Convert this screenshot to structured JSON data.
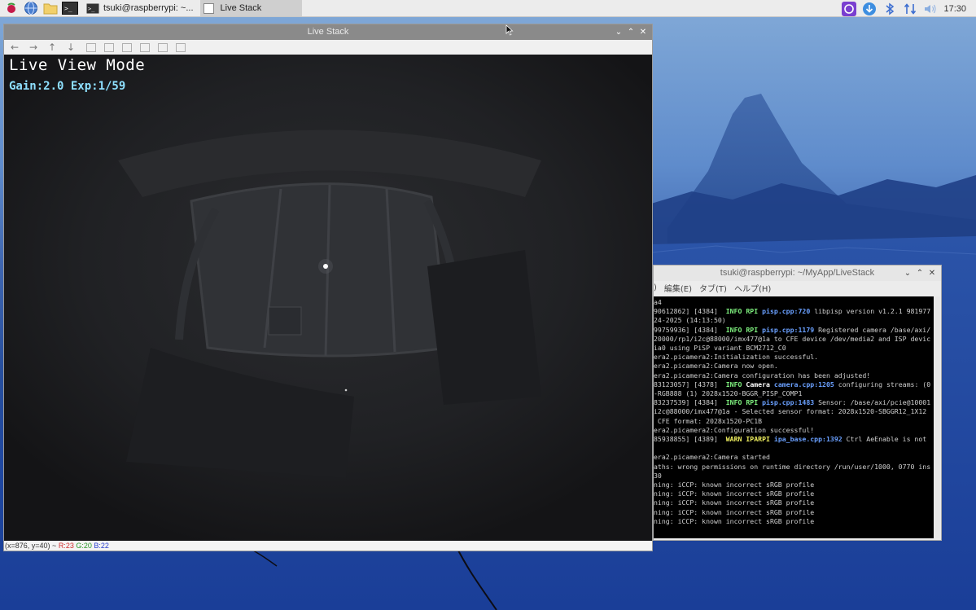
{
  "taskbar": {
    "icons": [
      "raspberry-menu-icon",
      "browser-globe-icon",
      "file-manager-folder-icon",
      "terminal-icon"
    ],
    "tasks": [
      {
        "label": "tsuki@raspberrypi: ~...",
        "icon": "terminal-icon",
        "active": false
      },
      {
        "label": "Live Stack",
        "icon": "window-icon",
        "active": true
      }
    ],
    "tray_icons": [
      "app-tray-icon",
      "download-update-icon",
      "bluetooth-icon",
      "network-arrows-icon",
      "volume-icon"
    ],
    "clock": "17:30"
  },
  "live_window": {
    "title": "Live Stack",
    "controls": [
      "minimize",
      "maximize",
      "close"
    ],
    "toolbar": [
      "back-arrow-icon",
      "forward-arrow-icon",
      "up-arrow-icon",
      "down-arrow-icon",
      "zoom-fit-icon",
      "zoom-in-icon",
      "zoom-out-icon",
      "save-icon",
      "copy-icon",
      "properties-icon"
    ],
    "overlay": {
      "mode": "Live View Mode",
      "gain_exposure": "Gain:2.0 Exp:1/59"
    },
    "status": {
      "coords": "(x=876, y=40) ~",
      "r": "R:23",
      "g": "G:20",
      "b": "B:22"
    }
  },
  "terminal_window": {
    "title": "tsuki@raspberrypi: ~/MyApp/LiveStack",
    "menu": [
      ")",
      "編集(E)",
      "タブ(T)",
      "ヘルプ(H)"
    ],
    "lines": [
      [
        {
          "t": "a4",
          "c": ""
        }
      ],
      [
        {
          "t": "90612862] [4384]  ",
          "c": ""
        },
        {
          "t": "INFO RPI ",
          "c": "info"
        },
        {
          "t": "pisp.cpp:720",
          "c": "src"
        },
        {
          "t": " libpisp version v1.2.1 981977",
          "c": ""
        }
      ],
      [
        {
          "t": "24-2025 (14:13:50)",
          "c": ""
        }
      ],
      [
        {
          "t": "99759936] [4384]  ",
          "c": ""
        },
        {
          "t": "INFO RPI ",
          "c": "info"
        },
        {
          "t": "pisp.cpp:1179",
          "c": "src"
        },
        {
          "t": " Registered camera /base/axi/",
          "c": ""
        }
      ],
      [
        {
          "t": "20000/rp1/i2c@88000/imx477@1a to CFE device /dev/media2 and ISP devic",
          "c": ""
        }
      ],
      [
        {
          "t": "ia0 using PiSP variant BCM2712_C0",
          "c": ""
        }
      ],
      [
        {
          "t": "era2.picamera2:Initialization successful.",
          "c": ""
        }
      ],
      [
        {
          "t": "era2.picamera2:Camera now open.",
          "c": ""
        }
      ],
      [
        {
          "t": "era2.picamera2:Camera configuration has been adjusted!",
          "c": ""
        }
      ],
      [
        {
          "t": "83123057] [4378]  ",
          "c": ""
        },
        {
          "t": "INFO ",
          "c": "info"
        },
        {
          "t": "Camera ",
          "c": "wb"
        },
        {
          "t": "camera.cpp:1205",
          "c": "src"
        },
        {
          "t": " configuring streams: (0",
          "c": ""
        }
      ],
      [
        {
          "t": "-RGB888 (1) 2028x1520-BGGR_PISP_COMP1",
          "c": ""
        }
      ],
      [
        {
          "t": "83237539] [4384]  ",
          "c": ""
        },
        {
          "t": "INFO RPI ",
          "c": "info"
        },
        {
          "t": "pisp.cpp:1483",
          "c": "src"
        },
        {
          "t": " Sensor: /base/axi/pcie@10001",
          "c": ""
        }
      ],
      [
        {
          "t": "i2c@88000/imx477@1a - Selected sensor format: 2028x1520-SBGGR12_1X12",
          "c": ""
        }
      ],
      [
        {
          "t": " CFE format: 2028x1520-PC1B",
          "c": ""
        }
      ],
      [
        {
          "t": "era2.picamera2:Configuration successful!",
          "c": ""
        }
      ],
      [
        {
          "t": "85938855] [4389]  ",
          "c": ""
        },
        {
          "t": "WARN IPARPI ",
          "c": "warn"
        },
        {
          "t": "ipa_base.cpp:1392",
          "c": "src"
        },
        {
          "t": " Ctrl AeEnable is not",
          "c": ""
        }
      ],
      [
        {
          "t": "",
          "c": ""
        }
      ],
      [
        {
          "t": "era2.picamera2:Camera started",
          "c": ""
        }
      ],
      [
        {
          "t": "aths: wrong permissions on runtime directory /run/user/1000, 0770 ins",
          "c": ""
        }
      ],
      [
        {
          "t": "30",
          "c": ""
        }
      ],
      [
        {
          "t": "ning: iCCP: known incorrect sRGB profile",
          "c": ""
        }
      ],
      [
        {
          "t": "ning: iCCP: known incorrect sRGB profile",
          "c": ""
        }
      ],
      [
        {
          "t": "ning: iCCP: known incorrect sRGB profile",
          "c": ""
        }
      ],
      [
        {
          "t": "ning: iCCP: known incorrect sRGB profile",
          "c": ""
        }
      ],
      [
        {
          "t": "ning: iCCP: known incorrect sRGB profile",
          "c": ""
        }
      ]
    ]
  },
  "colors": {
    "info": "#7ef07e",
    "warn": "#f0f060",
    "source": "#6aa0ff",
    "overlay_cyan": "#8ee0ff"
  }
}
